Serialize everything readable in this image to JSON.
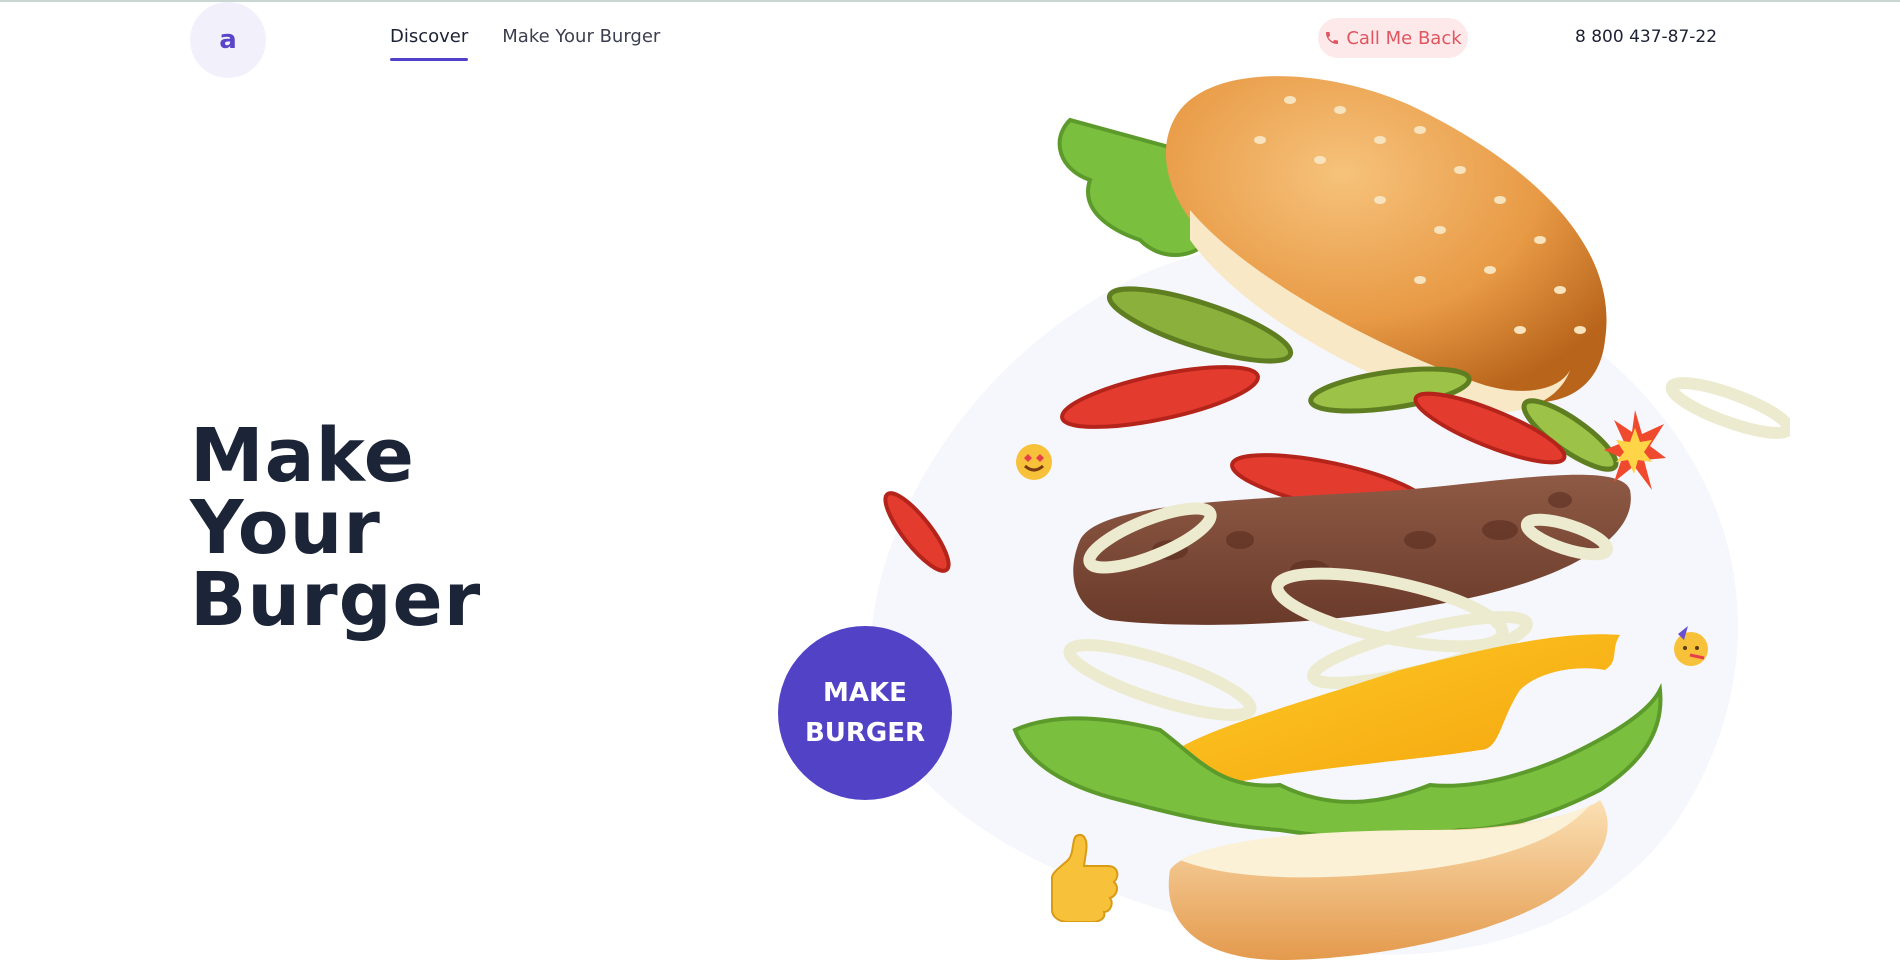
{
  "header": {
    "logo_letter": "a",
    "nav": [
      {
        "label": "Discover",
        "active": true
      },
      {
        "label": "Make Your Burger",
        "active": false
      }
    ],
    "call_button_label": "Call Me Back",
    "phone": "8 800 437-87-22"
  },
  "hero": {
    "title_lines": [
      "Make",
      "Your",
      "Burger"
    ],
    "cta_lines": [
      "MAKE",
      "BURGER"
    ]
  },
  "icons": {
    "phone": "phone-icon",
    "emoji_heart_eyes": "heart-eyes-emoji",
    "emoji_party": "party-face-emoji",
    "emoji_thumbs_up": "thumbs-up-emoji",
    "emoji_sparkle": "burst-icon"
  },
  "colors": {
    "accent": "#5243c6",
    "title": "#1c2538",
    "callback_bg": "#fde8ea",
    "callback_text": "#e0565f",
    "blob": "#f6f7fc"
  }
}
